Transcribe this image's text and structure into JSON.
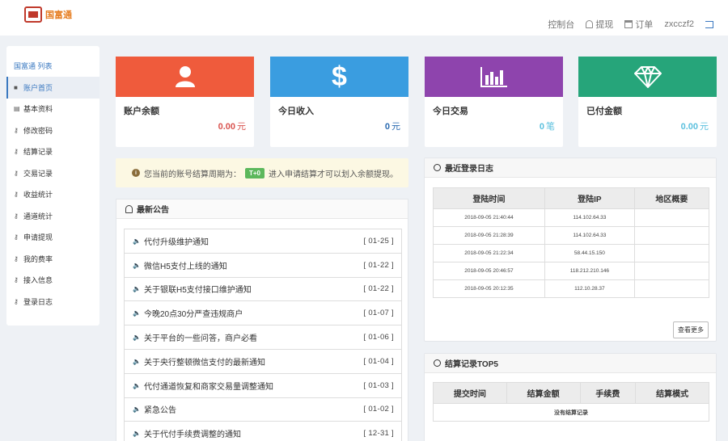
{
  "header": {
    "logo_text": "国富通",
    "nav": [
      {
        "label": "控制台",
        "icon": "none"
      },
      {
        "label": "提现",
        "icon": "bell-icon"
      },
      {
        "label": "订单",
        "icon": "calendar-icon"
      },
      {
        "label": "zxcczf2",
        "icon": "none"
      }
    ]
  },
  "sidebar": {
    "title": "国富通 列表",
    "items": [
      {
        "label": "账户首页",
        "icon": "home-icon",
        "active": true
      },
      {
        "label": "基本资料",
        "icon": "bar-chart-icon"
      },
      {
        "label": "修改密码",
        "icon": "key-icon"
      },
      {
        "label": "结算记录",
        "icon": "key-icon"
      },
      {
        "label": "交易记录",
        "icon": "key-icon"
      },
      {
        "label": "收益统计",
        "icon": "key-icon"
      },
      {
        "label": "通道统计",
        "icon": "key-icon"
      },
      {
        "label": "申请提现",
        "icon": "key-icon"
      },
      {
        "label": "我的费率",
        "icon": "key-icon"
      },
      {
        "label": "接入信息",
        "icon": "key-icon"
      },
      {
        "label": "登录日志",
        "icon": "key-icon"
      }
    ]
  },
  "cards": [
    {
      "label": "账户余额",
      "value": "0.00",
      "unit": "元",
      "color": "#ef5b3c",
      "value_color": "#d9534f",
      "icon": "user-icon"
    },
    {
      "label": "今日收入",
      "value": "0",
      "unit": "元",
      "color": "#3a9de0",
      "value_color": "#2a6ab0",
      "icon": "dollar-icon"
    },
    {
      "label": "今日交易",
      "value": "0",
      "unit": "笔",
      "color": "#8e44ad",
      "value_color": "#5bc0de",
      "icon": "bar-chart-icon"
    },
    {
      "label": "已付金额",
      "value": "0.00",
      "unit": "元",
      "color": "#26a57a",
      "value_color": "#5bc0de",
      "icon": "diamond-icon"
    }
  ],
  "notice": {
    "text_before": "您当前的账号结算周期为：",
    "badge": "T+0",
    "text_after": "进入申请结算才可以划入余额提现。"
  },
  "announcements": {
    "title": "最新公告",
    "items": [
      {
        "title": "代付升级维护通知",
        "date": "[ 01-25 ]"
      },
      {
        "title": "微信H5支付上线的通知",
        "date": "[ 01-22 ]"
      },
      {
        "title": "关于银联H5支付接口维护通知",
        "date": "[ 01-22 ]"
      },
      {
        "title": "今晚20点30分严查违规商户",
        "date": "[ 01-07 ]"
      },
      {
        "title": "关于平台的一些问答，商户必看",
        "date": "[ 01-06 ]"
      },
      {
        "title": "关于央行整顿微信支付的最新通知",
        "date": "[ 01-04 ]"
      },
      {
        "title": "代付通道恢复和商家交易量调整通知",
        "date": "[ 01-03 ]"
      },
      {
        "title": "紧急公告",
        "date": "[ 01-02 ]"
      },
      {
        "title": "关于代付手续费调整的通知",
        "date": "[ 12-31 ]"
      }
    ]
  },
  "login_log": {
    "title": "最近登录日志",
    "columns": [
      "登陆时间",
      "登陆IP",
      "地区概要"
    ],
    "rows": [
      [
        "2018-09-05 21:40:44",
        "114.102.64.33",
        ""
      ],
      [
        "2018-09-05 21:28:39",
        "114.102.64.33",
        ""
      ],
      [
        "2018-09-05 21:22:34",
        "58.44.15.150",
        ""
      ],
      [
        "2018-09-05 20:46:57",
        "118.212.210.146",
        ""
      ],
      [
        "2018-09-05 20:12:35",
        "112.10.28.37",
        ""
      ]
    ],
    "more_button": "查看更多"
  },
  "settlement": {
    "title": "结算记录TOP5",
    "columns": [
      "提交时间",
      "结算金额",
      "手续费",
      "结算模式"
    ],
    "empty_text": "没有结算记录"
  }
}
